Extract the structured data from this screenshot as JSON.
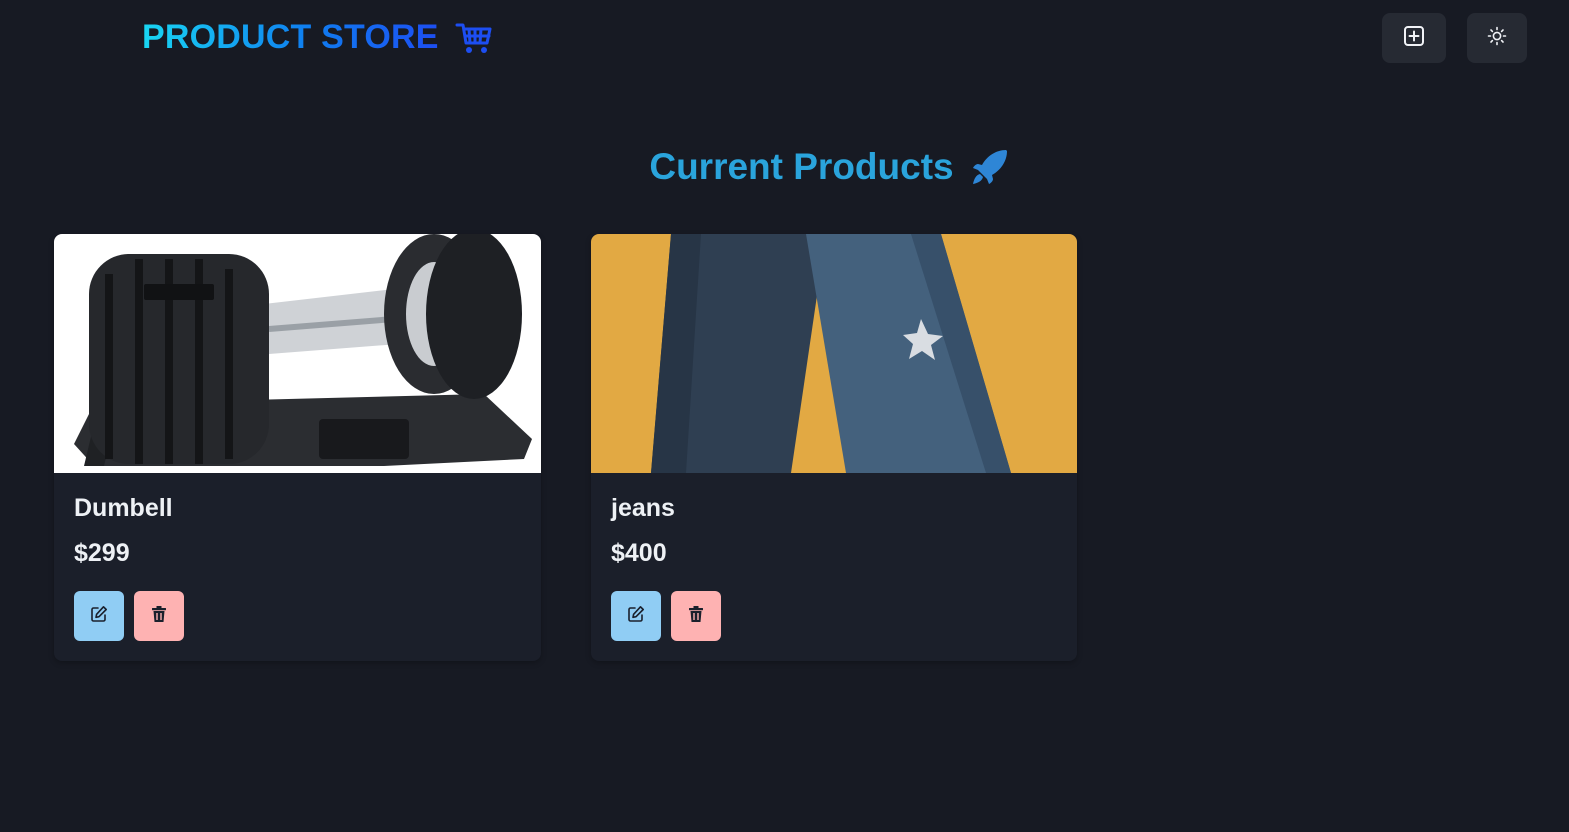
{
  "header": {
    "brand_title": "PRODUCT STORE",
    "brand_icon": "shopping-cart-icon",
    "create_button_icon": "plus-square-icon",
    "theme_button_icon": "sun-icon"
  },
  "main": {
    "section_title": "Current Products",
    "section_icon": "rocket-icon",
    "products": [
      {
        "name": "Dumbell",
        "price": "$299",
        "image": "adjustable-dumbbell-photo",
        "edit_icon": "edit-icon",
        "delete_icon": "trash-icon"
      },
      {
        "name": "jeans",
        "price": "$400",
        "image": "jeans-photo",
        "edit_icon": "edit-icon",
        "delete_icon": "trash-icon"
      }
    ]
  },
  "colors": {
    "background": "#171a23",
    "card": "#1b1f2a",
    "accent": "#2aa4dc",
    "brand_gradient_start": "#19d6f2",
    "brand_gradient_end": "#1d4ef2",
    "edit_button": "#90cdf4",
    "delete_button": "#feb2b2"
  }
}
